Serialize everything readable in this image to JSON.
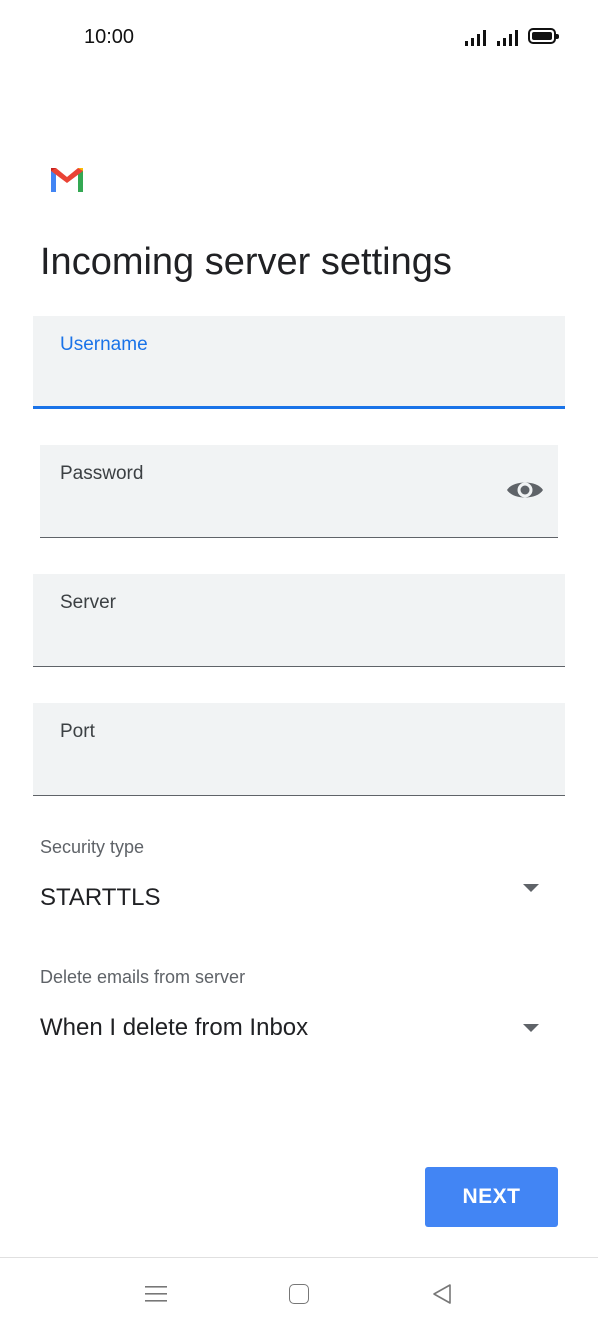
{
  "status_bar": {
    "time": "10:00"
  },
  "page": {
    "title": "Incoming server settings"
  },
  "fields": {
    "username": {
      "label": "Username",
      "value": ""
    },
    "password": {
      "label": "Password",
      "value": ""
    },
    "server": {
      "label": "Server",
      "value": ""
    },
    "port": {
      "label": "Port",
      "value": ""
    }
  },
  "security_type": {
    "label": "Security type",
    "value": "STARTTLS"
  },
  "delete_emails": {
    "label": "Delete emails from server",
    "value": "When I delete from Inbox"
  },
  "actions": {
    "next_label": "NEXT"
  },
  "icons": {
    "logo": "gmail-logo",
    "password_toggle": "eye-icon",
    "nav": [
      "menu-icon",
      "home-icon",
      "back-icon"
    ]
  },
  "colors": {
    "accent": "#1a73e8",
    "button": "#4285f4",
    "field_bg": "#f1f3f4"
  }
}
